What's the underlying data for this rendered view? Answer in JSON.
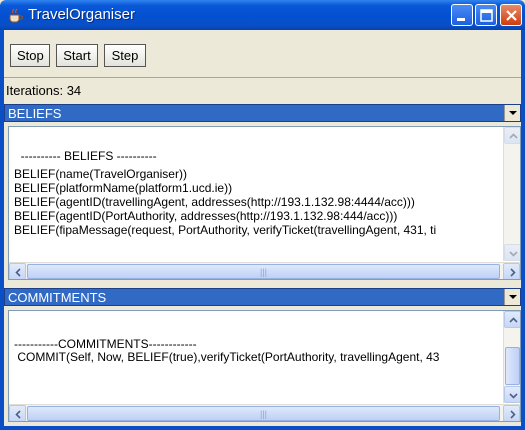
{
  "window": {
    "title": "TravelOrganiser"
  },
  "toolbar": {
    "stop_label": "Stop",
    "start_label": "Start",
    "step_label": "Step"
  },
  "status": {
    "iterations": "Iterations: 34"
  },
  "beliefs": {
    "section_label": "BELIEFS",
    "lines": [
      "  ---------- BELIEFS ----------",
      "BELIEF(name(TravelOrganiser))",
      "BELIEF(platformName(platform1.ucd.ie))",
      "BELIEF(agentID(travellingAgent, addresses(http://193.1.132.98:4444/acc)))",
      "BELIEF(agentID(PortAuthority, addresses(http://193.1.132.98:444/acc)))",
      "BELIEF(fipaMessage(request, PortAuthority, verifyTicket(travellingAgent, 431, ti"
    ]
  },
  "commitments": {
    "section_label": "COMMITMENTS",
    "lines": [
      "-----------COMMITMENTS------------",
      " COMMIT(Self, Now, BELIEF(true),verifyTicket(PortAuthority, travellingAgent, 43"
    ]
  },
  "icons": {
    "app": "java-cup-icon",
    "minimize": "minimize-icon",
    "maximize": "maximize-icon",
    "close": "close-icon",
    "dropdown": "chevron-down-icon"
  },
  "colors": {
    "titlebar": "#0a58d8",
    "section_bar": "#316ac5",
    "close_button": "#cc3d11"
  }
}
